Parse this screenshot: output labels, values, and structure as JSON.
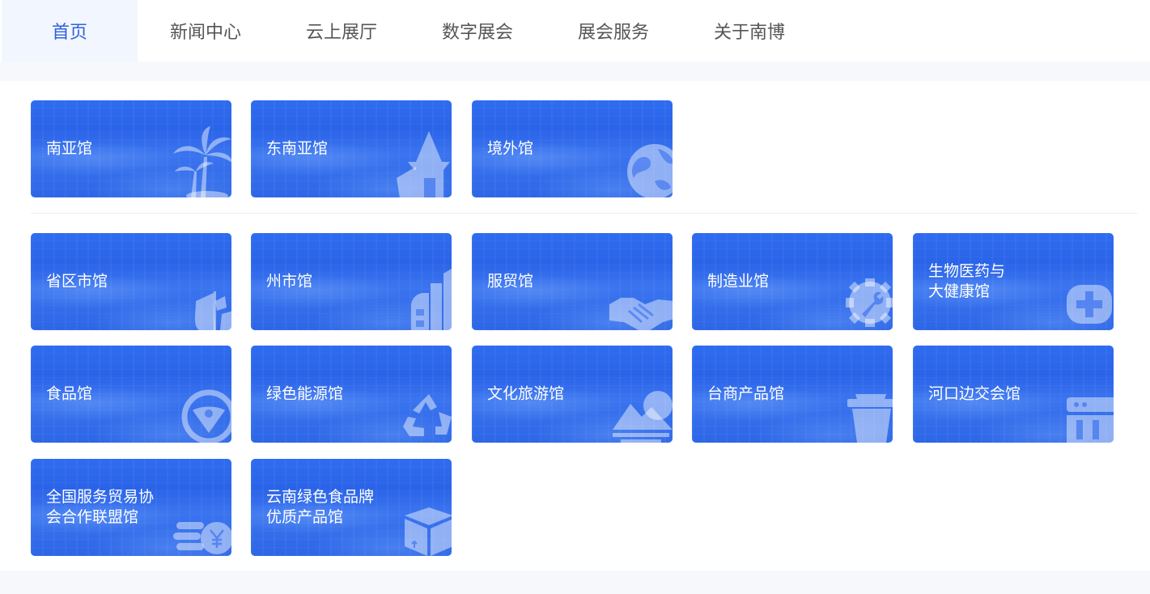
{
  "nav": {
    "items": [
      {
        "label": "首页",
        "active": true
      },
      {
        "label": "新闻中心",
        "active": false
      },
      {
        "label": "云上展厅",
        "active": false
      },
      {
        "label": "数字展会",
        "active": false
      },
      {
        "label": "展会服务",
        "active": false
      },
      {
        "label": "关于南博",
        "active": false
      }
    ]
  },
  "halls_top": [
    {
      "label": "南亚馆",
      "icon": "palm-tree-icon"
    },
    {
      "label": "东南亚馆",
      "icon": "pagoda-icon"
    },
    {
      "label": "境外馆",
      "icon": "globe-icon"
    }
  ],
  "halls": [
    {
      "label": "省区市馆",
      "icon": "map-flag-icon"
    },
    {
      "label": "州市馆",
      "icon": "buildings-icon"
    },
    {
      "label": "服贸馆",
      "icon": "handshake-icon"
    },
    {
      "label": "制造业馆",
      "icon": "gear-wrench-icon"
    },
    {
      "label": "生物医药与\n大健康馆",
      "icon": "medical-cross-icon"
    },
    {
      "label": "食品馆",
      "icon": "food-badge-icon"
    },
    {
      "label": "绿色能源馆",
      "icon": "recycle-icon"
    },
    {
      "label": "文化旅游馆",
      "icon": "mountain-sun-icon"
    },
    {
      "label": "台商产品馆",
      "icon": "cup-icon"
    },
    {
      "label": "河口边交会馆",
      "icon": "booth-icon"
    },
    {
      "label": "全国服务贸易协\n会合作联盟馆",
      "icon": "coins-yen-icon"
    },
    {
      "label": "云南绿色食品牌\n优质产品馆",
      "icon": "package-box-icon"
    }
  ],
  "colors": {
    "accent": "#2f62d9",
    "card": "#2d68ec"
  }
}
